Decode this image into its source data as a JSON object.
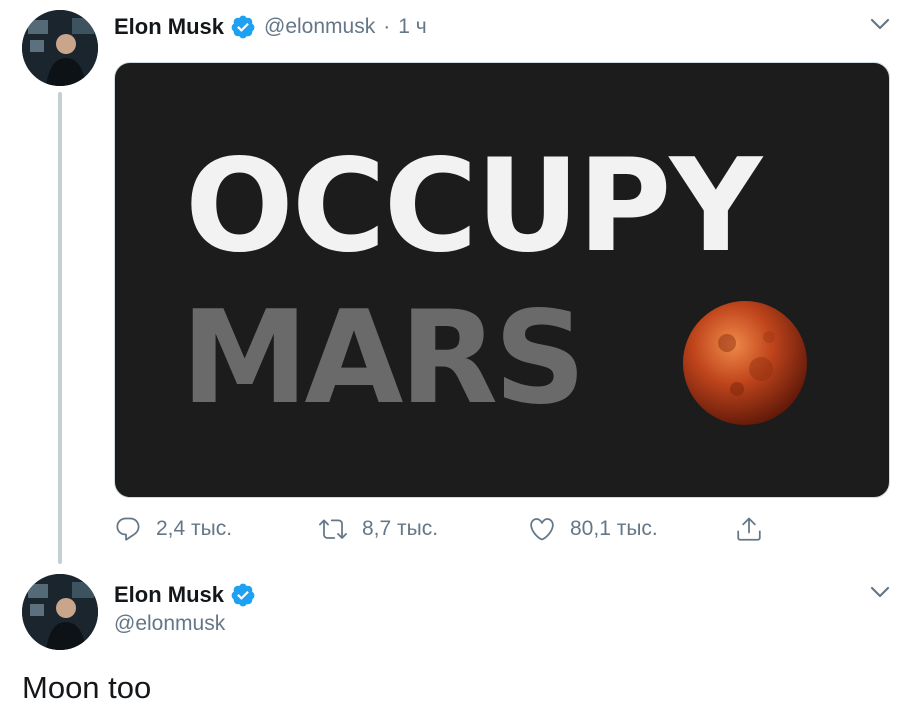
{
  "tweet1": {
    "author_name": "Elon Musk",
    "handle": "@elonmusk",
    "separator": "·",
    "time": "1 ч",
    "media": {
      "line1": "OCCUPY",
      "line2": "MARS"
    },
    "actions": {
      "reply_count": "2,4 тыс.",
      "retweet_count": "8,7 тыс.",
      "like_count": "80,1 тыс."
    }
  },
  "tweet2": {
    "author_name": "Elon Musk",
    "handle": "@elonmusk",
    "text": "Moon too"
  },
  "colors": {
    "verified": "#1da1f2",
    "secondary_text": "#657786",
    "media_bg": "#1c1c1c",
    "mars": "#c0451c"
  },
  "icons": [
    "verified-badge-icon",
    "chevron-down-icon",
    "reply-icon",
    "retweet-icon",
    "like-icon",
    "share-icon"
  ]
}
